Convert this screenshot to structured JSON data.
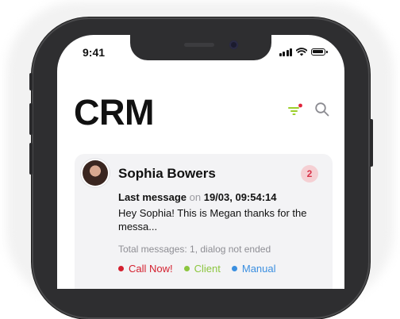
{
  "status_bar": {
    "time": "9:41"
  },
  "header": {
    "title": "CRM",
    "filter_dot_color": "#e0243a",
    "filter_color": "#9ccf2a"
  },
  "card": {
    "name": "Sophia Bowers",
    "unread_count": "2",
    "last_message_label": "Last message",
    "on_word": "on",
    "timestamp": "19/03, 09:54:14",
    "message": "Hey Sophia! This is Megan thanks for the messa...",
    "total": "Total messages: 1, dialog not ended",
    "tags": [
      {
        "label": "Call Now!",
        "color": "#d4202f"
      },
      {
        "label": "Client",
        "color": "#8cc63f"
      },
      {
        "label": "Manual",
        "color": "#3b8fe0"
      }
    ]
  },
  "icons": {
    "filter": "filter-icon",
    "search": "search-icon",
    "signal": "signal-icon",
    "wifi": "wifi-icon",
    "battery": "battery-icon"
  }
}
